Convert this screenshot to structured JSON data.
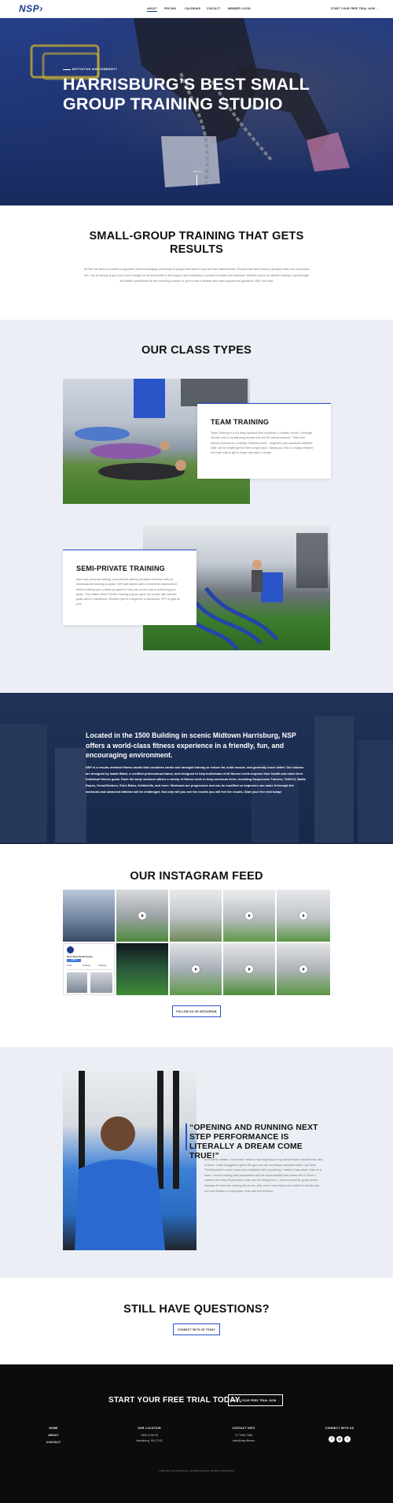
{
  "header": {
    "logo": "NSP",
    "nav": [
      "ABOUT",
      "PRICING",
      "CALENDAR",
      "CONTACT",
      "MEMBER LOGIN"
    ],
    "cta": "START YOUR FREE TRIAL NOW  →"
  },
  "hero": {
    "kicker": "MOTIVATION AND COMMUNITY",
    "title": "HARRISBURG’S BEST SMALL GROUP TRAINING STUDIO",
    "scroll": "SCROLL"
  },
  "intro": {
    "title": "SMALL-GROUP TRAINING THAT GETS RESULTS",
    "body": "At NSP we seek to provide a supportive and encouraging community of people that want to improve their fitness levels. People that have turned a question mark into a checked box. Life is coming at you from a lot of angles so its imperative to find support and motivation in pursuit of health and wellness. Whether you’re an athlete looking to get stronger and better conditioned for the upcoming season or you’re new to fitness and need support and guidance, NSP can help!"
  },
  "classes": {
    "title": "OUR CLASS TYPES",
    "team": {
      "title": "TEAM TRAINING",
      "body": "Team Training is a 6-8 deep workout that combines 1 mobility circuit, 2 strength circuits, and 2 conditioning circuits into one 50-minute workout. This is the perfect workout for a variety of fitness levels - beginners and advanced athletes alike, will be challenged at their unique pace. Simply put, this is a highly efficient and safe way to get in shape and stay in shape."
    },
    "semi": {
      "title": "SEMI-PRIVATE TRAINING",
      "body": "Much like personal training, semi-private training provides members with an individualized training program. We’ll get started with a movement assessment before building your custom program to help you on the way to achieving your goals. This makes Semi-Private Training a good option for people with specific goals and or restrictions. Whether you’re a beginner or advanced, SPT is right for you!"
    }
  },
  "location": {
    "lead": "Located in the 1500 Building in scenic Midtown Harrisburg, NSP offers a world-class fitness experience in a friendly, fun, and encouraging environment.",
    "body": "NSP is a results-oriented fitness studio that combines cardio and strength training to reduce fat, build muscle, and generally move better. Our classes are designed by Isaiah Black, a certified professional trainer, and designed to help individuals of all fitness levels improve their health and reach their individual fitness goals. Each full-body workout utilizes a variety of fitness tools to keep workouts fresh, including Suspension Trainers, TedFLG, Battle Ropes, VersaClimbers, Echo Bikes, Kettlebells, and more. Workouts are progressive and can be modified so beginners can make it through the workouts and advanced athletes will be challenged. Not only will you see the results you will feel the results. Start your free trial today!"
  },
  "instagram": {
    "title": "OUR INSTAGRAM FEED",
    "profile_name": "Next Step Performance",
    "profile_follow": "Follow",
    "profile_posts": "Posts",
    "profile_followers": "Followers",
    "profile_following": "Following",
    "button": "FOLLOW US ON INSTAGRAM"
  },
  "testimonial": {
    "quote": "“OPENING AND RUNNING NEXT STEP PERFORMANCE IS LITERALLY A DREAM COME TRUE!”",
    "body": "As a former athlete, I know that I need to train regularly for my overall health and wellness. But at times, I have struggled to get to the gym and am not always motivated when I get there. Thinking back to when I was most consistent with my training, I realize it was when I was on a team. I thrived training with camaraderie and the accountability that comes with it. When I created Next Step Performance, that was the driving force. I knew it would be group fitness because it’s been the missing link for me. And, when I have found out is that I’m not the only one who thrives in a supportive, team-like environment."
  },
  "questions": {
    "title": "STILL HAVE QUESTIONS?",
    "button": "CONNECT WITH US TODAY"
  },
  "footer": {
    "cta": "START YOUR FREE TRIAL TODAY.",
    "cta_button": "START YOUR FREE TRIAL NOW  →",
    "links": [
      "HOME",
      "ABOUT",
      "CONTACT"
    ],
    "location_head": "OUR LOCATION",
    "address1": "1500 N 6th St",
    "address2": "Harrisburg, PA 17102",
    "contact_head": "CONTACT INFO",
    "phone": "717-606-7466",
    "email": "train@nsp.fitness",
    "connect_head": "CONNECT WITH US",
    "copyright": "© 2021 Next Step Performance. All Rights Reserved. Website by Daniel Black."
  }
}
